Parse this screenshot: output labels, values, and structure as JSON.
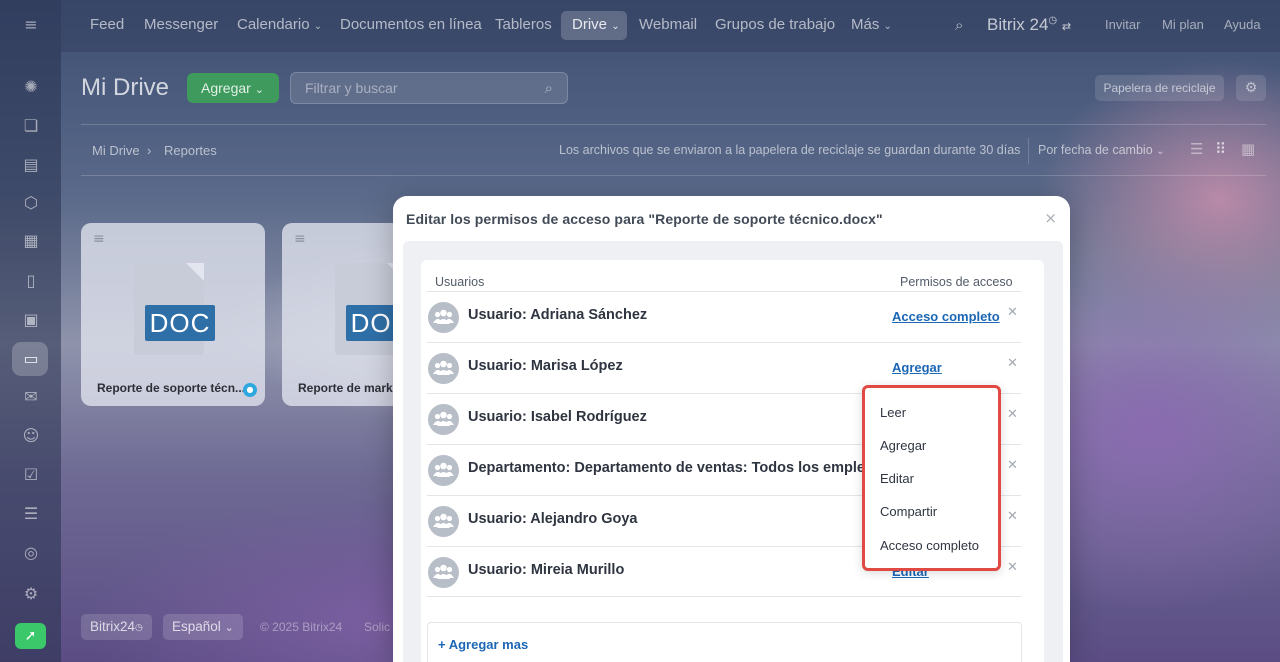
{
  "sidebar": {
    "icons": [
      "menu-icon",
      "feed-icon",
      "chat-icon",
      "tasks-icon",
      "crm-icon",
      "calendar-icon",
      "docs-icon",
      "board-icon",
      "drive-icon",
      "mail-icon",
      "groups-icon",
      "check-icon",
      "filter-icon",
      "robot-icon",
      "settings-icon",
      "rocket-icon"
    ]
  },
  "topnav": {
    "items": [
      "Feed",
      "Messenger",
      "Calendario",
      "Documentos en línea",
      "Tableros",
      "Drive",
      "Webmail",
      "Grupos de trabajo",
      "Más"
    ],
    "brand": "Bitrix 24",
    "invite": "Invitar",
    "plan": "Mi plan",
    "help": "Ayuda"
  },
  "header": {
    "title": "Mi Drive",
    "add_label": "Agregar",
    "search_placeholder": "Filtrar y buscar",
    "trash_label": "Papelera de reciclaje"
  },
  "breadcrumb": {
    "root": "Mi Drive",
    "current": "Reportes"
  },
  "info_text": "Los archivos que se enviaron a la papelera de reciclaje se guardan durante 30 días",
  "sort_label": "Por fecha de cambio",
  "files": [
    {
      "badge": "DOC",
      "name": "Reporte de soporte técn..."
    },
    {
      "badge": "DOC",
      "name": "Reporte de marke"
    }
  ],
  "footer": {
    "brand": "Bitrix24",
    "language": "Español",
    "copyright": "© 2025 Bitrix24",
    "extra": "Solic"
  },
  "dialog": {
    "title": "Editar los permisos de acceso para \"Reporte de soporte técnico.docx\"",
    "col_users": "Usuarios",
    "col_perms": "Permisos de acceso",
    "rows": [
      {
        "name": "Usuario: Adriana Sánchez",
        "perm": "Acceso completo"
      },
      {
        "name": "Usuario: Marisa López",
        "perm": "Agregar"
      },
      {
        "name": "Usuario: Isabel Rodríguez",
        "perm": ""
      },
      {
        "name": "Departamento: Departamento de ventas: Todos los emple",
        "perm": ""
      },
      {
        "name": "Usuario: Alejandro Goya",
        "perm": ""
      },
      {
        "name": "Usuario: Mireia Murillo",
        "perm": "Editar"
      }
    ],
    "add_more": "+ Agregar mas"
  },
  "dropdown": {
    "options": [
      "Leer",
      "Agregar",
      "Editar",
      "Compartir",
      "Acceso completo"
    ],
    "highlight_color": "#e04a43"
  }
}
